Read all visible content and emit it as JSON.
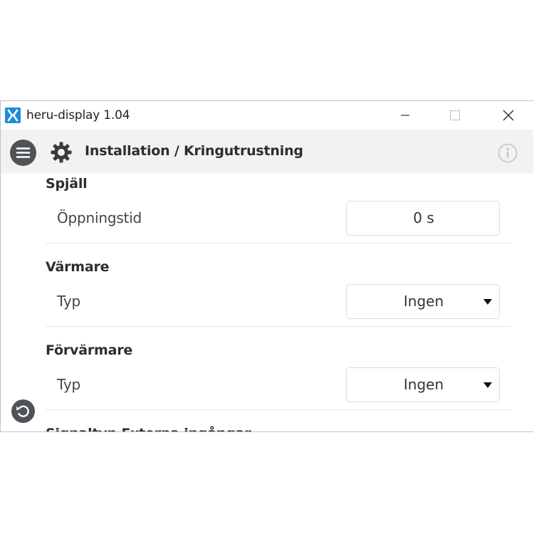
{
  "window": {
    "title": "heru-display 1.04"
  },
  "header": {
    "title": "Installation / Kringutrustning"
  },
  "sections": [
    {
      "title": "Spjäll",
      "rows": [
        {
          "label": "Öppningstid",
          "value": "0 s",
          "control": "input"
        }
      ]
    },
    {
      "title": "Värmare",
      "rows": [
        {
          "label": "Typ",
          "value": "Ingen",
          "control": "dropdown"
        }
      ]
    },
    {
      "title": "Förvärmare",
      "rows": [
        {
          "label": "Typ",
          "value": "Ingen",
          "control": "dropdown"
        }
      ]
    },
    {
      "title": "Signaltyp Externa ingångar"
    }
  ],
  "icons": {
    "app": "heru-logo-icon",
    "menu": "hamburger-menu-icon",
    "settings": "gear-icon",
    "info": "info-icon",
    "back": "back-arrow-icon",
    "minimize": "minimize-icon",
    "maximize": "maximize-icon",
    "close": "close-icon"
  },
  "colors": {
    "logo": "#1c8bd8",
    "header_bg": "#f2f2f2",
    "button_dark": "#4f5257"
  }
}
